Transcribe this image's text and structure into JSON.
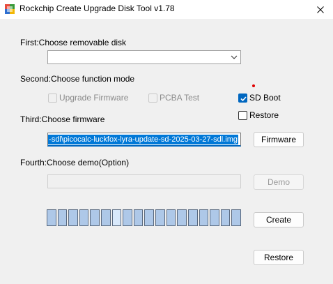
{
  "window": {
    "title": "Rockchip Create Upgrade Disk Tool v1.78",
    "icon": "app-icon",
    "close_icon": "close-icon"
  },
  "first": {
    "label": "First:Choose removable disk",
    "disk_selected": ""
  },
  "second": {
    "label": "Second:Choose function mode",
    "options": [
      {
        "label": "Upgrade Firmware",
        "checked": false,
        "enabled": false
      },
      {
        "label": "PCBA Test",
        "checked": false,
        "enabled": false
      },
      {
        "label": "SD Boot",
        "checked": true,
        "enabled": true
      },
      {
        "label": "Restore",
        "checked": false,
        "enabled": true
      }
    ]
  },
  "third": {
    "label": "Third:Choose firmware",
    "firmware_path": "-sdl\\picocalc-luckfox-lyra-update-sd-2025-03-27-sdl.img",
    "button": "Firmware"
  },
  "fourth": {
    "label": "Fourth:Choose demo(Option)",
    "demo_path": "",
    "button": "Demo"
  },
  "progress": {
    "segments": 18,
    "highlighted_segment": 6
  },
  "buttons": {
    "create": "Create",
    "restore": "Restore"
  },
  "colors": {
    "accent": "#0067c0",
    "selection": "#0078d7",
    "progress_segment": "#aec8e8",
    "indicator_dot": "#e00000"
  }
}
